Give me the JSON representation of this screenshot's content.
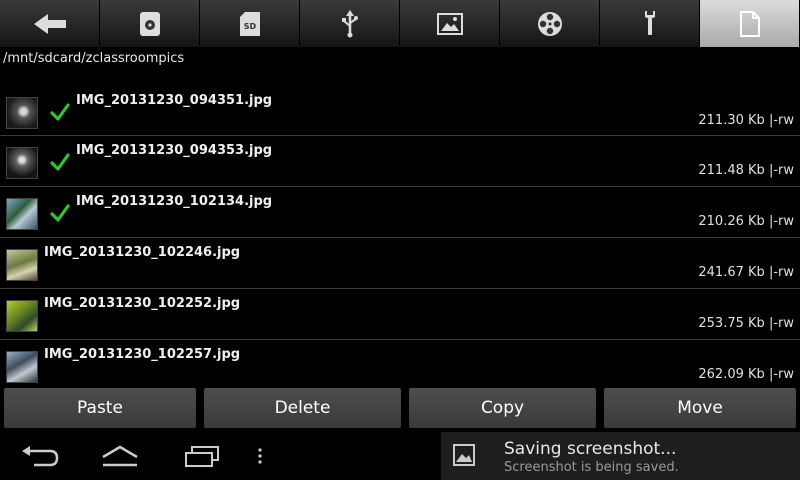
{
  "toolbar": {
    "buttons": [
      {
        "icon": "back-arrow-icon"
      },
      {
        "icon": "internal-storage-icon"
      },
      {
        "icon": "sd-card-icon",
        "text": "SD"
      },
      {
        "icon": "usb-icon"
      },
      {
        "icon": "image-icon"
      },
      {
        "icon": "video-reel-icon"
      },
      {
        "icon": "wrench-icon"
      },
      {
        "icon": "file-icon",
        "active": true
      }
    ]
  },
  "path": "/mnt/sdcard/zclassroompics",
  "files": [
    {
      "name": "IMG_20131230_094351.jpg",
      "size": "211.30 Kb",
      "perm": "|-rw",
      "checked": true
    },
    {
      "name": "IMG_20131230_094353.jpg",
      "size": "211.48 Kb",
      "perm": "|-rw",
      "checked": true
    },
    {
      "name": "IMG_20131230_102134.jpg",
      "size": "210.26 Kb",
      "perm": "|-rw",
      "checked": true
    },
    {
      "name": "IMG_20131230_102246.jpg",
      "size": "241.67 Kb",
      "perm": "|-rw",
      "checked": false
    },
    {
      "name": "IMG_20131230_102252.jpg",
      "size": "253.75 Kb",
      "perm": "|-rw",
      "checked": false
    },
    {
      "name": "IMG_20131230_102257.jpg",
      "size": "262.09 Kb",
      "perm": "|-rw",
      "checked": false
    }
  ],
  "actions": {
    "paste": "Paste",
    "delete": "Delete",
    "copy": "Copy",
    "move": "Move"
  },
  "notification": {
    "title": "Saving screenshot...",
    "subtitle": "Screenshot is being saved."
  },
  "colors": {
    "check": "#2ec52e",
    "active_tab": "#c8c8c8"
  }
}
